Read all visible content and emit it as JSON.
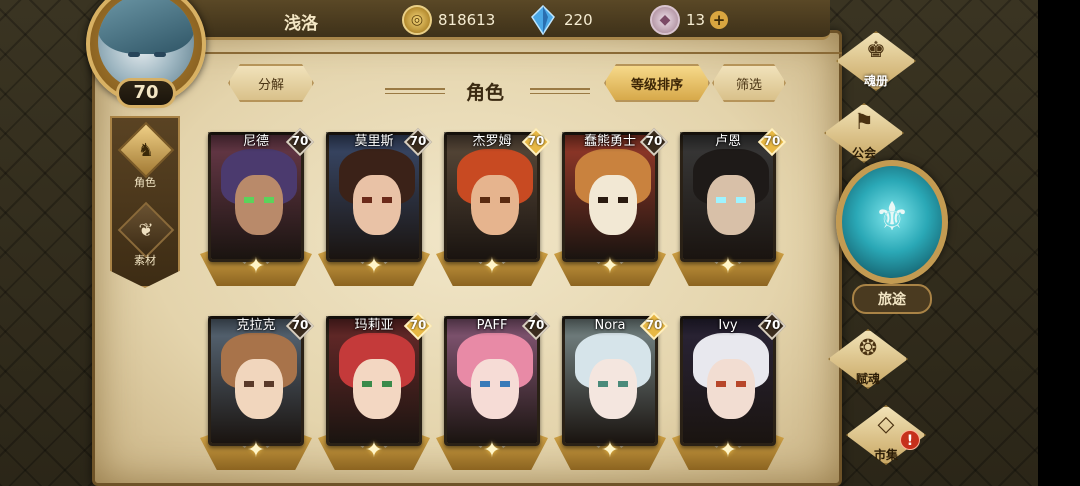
{
  "player": {
    "name": "浅洛",
    "level": "70"
  },
  "currency": {
    "gold": "818613",
    "crystal": "220",
    "gem": "13"
  },
  "header": {
    "title": "角色",
    "decompose_label": "分解",
    "sort_label": "等级排序",
    "filter_label": "筛选"
  },
  "left_tabs": [
    {
      "label": "角色"
    },
    {
      "label": "素材"
    }
  ],
  "heroes": [
    {
      "name": "尼德",
      "level": "70",
      "badge": "dark",
      "hair": "#4b3a6e",
      "skin": "#b98a6a",
      "eye": "#5bd35b",
      "bg": "#6b3a4a"
    },
    {
      "name": "莫里斯",
      "level": "70",
      "badge": "dark",
      "hair": "#3b2218",
      "skin": "#e9c2a6",
      "eye": "#6b2a1a",
      "bg": "#3a4a6b"
    },
    {
      "name": "杰罗姆",
      "level": "70",
      "badge": "gold",
      "hair": "#c84a22",
      "skin": "#e6b48e",
      "eye": "#5a2a10",
      "bg": "#5a4a3a"
    },
    {
      "name": "蠢熊勇士",
      "level": "70",
      "badge": "dark",
      "hair": "#c9823e",
      "skin": "#f2e8d4",
      "eye": "#2a1a10",
      "bg": "#9a3a2a"
    },
    {
      "name": "卢恩",
      "level": "70",
      "badge": "gold",
      "hair": "#1e1a18",
      "skin": "#d8c0a8",
      "eye": "#9ef3ff",
      "bg": "#3a3a3a"
    },
    {
      "name": "克拉克",
      "level": "70",
      "badge": "dark",
      "hair": "#a8734a",
      "skin": "#f1d6bd",
      "eye": "#5a3a2a",
      "bg": "#5a6a7a"
    },
    {
      "name": "玛莉亚",
      "level": "70",
      "badge": "gold",
      "hair": "#c43a3a",
      "skin": "#f3d7c2",
      "eye": "#3a8a4a",
      "bg": "#6a2a2a"
    },
    {
      "name": "PAFF",
      "level": "70",
      "badge": "dark",
      "hair": "#e88aa6",
      "skin": "#f6dcd6",
      "eye": "#3a7ab8",
      "bg": "#8a5a7a"
    },
    {
      "name": "Nora",
      "level": "70",
      "badge": "gold",
      "hair": "#d6e4ea",
      "skin": "#f4e6df",
      "eye": "#4a8a7a",
      "bg": "#7a8a8a"
    },
    {
      "name": "Ivy",
      "level": "70",
      "badge": "dark",
      "hair": "#e8e8ee",
      "skin": "#f2ddd2",
      "eye": "#b8462a",
      "bg": "#2a2438"
    }
  ],
  "right_nav": {
    "soul_book": "魂册",
    "guild": "公会",
    "journey": "旅途",
    "talent_soul": "赋魂",
    "market": "市集"
  }
}
